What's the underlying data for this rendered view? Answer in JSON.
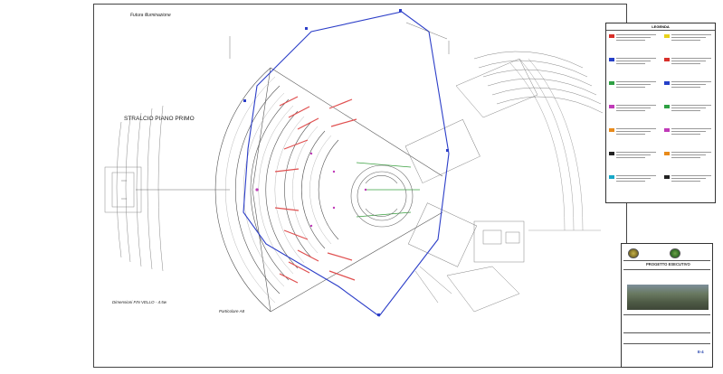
{
  "drawing": {
    "top_label": "Futura illuminazione",
    "plan_title": "STRALCIO PIANO PRIMO",
    "dimension_note": "Dimensioni FIN VELLO - 4.5w",
    "detail_label": "Particolare A8"
  },
  "legend": {
    "heading": "LEGENDA",
    "colors": {
      "red": "#d8302a",
      "blue": "#2540c8",
      "green": "#2ea043",
      "magenta": "#c03ab8",
      "orange": "#e88a1a",
      "black": "#222222",
      "cyan": "#18a8c8",
      "yellow": "#e8d21a"
    }
  },
  "title_block": {
    "heading": "PROGETTO ESECUTIVO",
    "sheet_code": "E-4",
    "logos": [
      "region-emblem",
      "municipality-emblem"
    ]
  },
  "colors": {
    "boundary": "#2c3ec8",
    "hall_red": "#e05050",
    "accent_green": "#3aa040",
    "linework": "#6a6a6a"
  }
}
